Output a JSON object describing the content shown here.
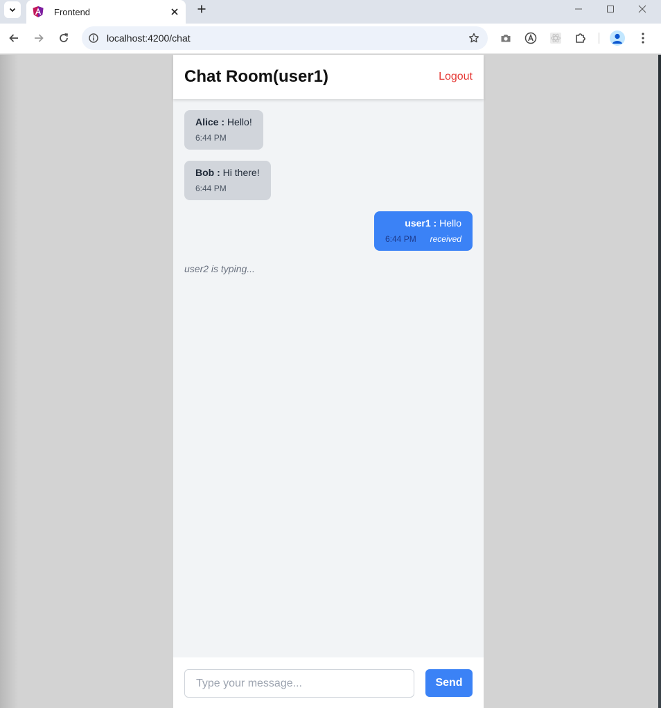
{
  "browser": {
    "tab_title": "Frontend",
    "url": "localhost:4200/chat"
  },
  "chat": {
    "title": "Chat Room(user1)",
    "logout_label": "Logout",
    "messages": [
      {
        "sender": "Alice",
        "separator": " : ",
        "text": "Hello!",
        "time": "6:44 PM",
        "own": false
      },
      {
        "sender": "Bob",
        "separator": " : ",
        "text": "Hi there!",
        "time": "6:44 PM",
        "own": false
      },
      {
        "sender": "user1",
        "separator": " : ",
        "text": "Hello",
        "time": "6:44 PM",
        "status": "received",
        "own": true
      }
    ],
    "typing_indicator": "user2 is typing...",
    "input_placeholder": "Type your message...",
    "send_label": "Send"
  },
  "colors": {
    "accent": "#3b82f6",
    "logout": "#e53935",
    "incoming_bubble": "#d1d5db"
  }
}
